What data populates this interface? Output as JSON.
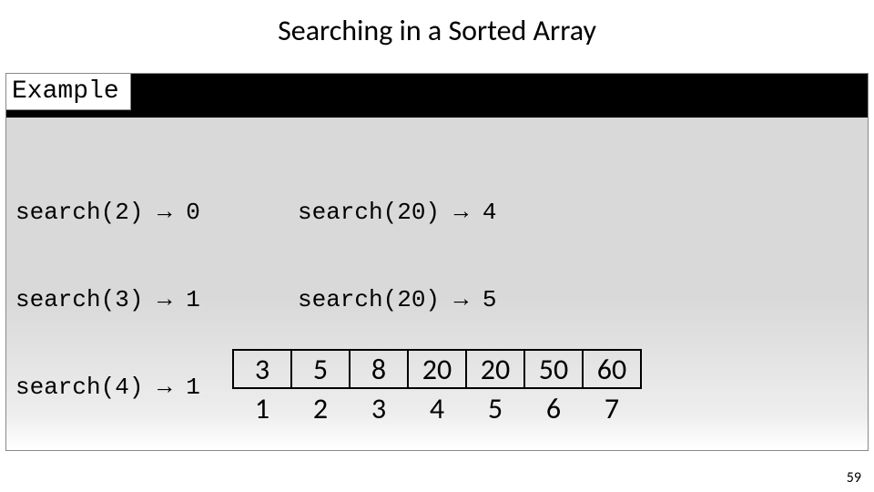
{
  "title": "Searching in a Sorted Array",
  "banner_label": "Example",
  "page_number": "59",
  "left_calls": [
    "search(2) → 0",
    "search(3) → 1",
    "search(4) → 1"
  ],
  "right_calls": [
    "search(20) → 4",
    "search(20) → 5"
  ],
  "array_values": [
    "3",
    "5",
    "8",
    "20",
    "20",
    "50",
    "60"
  ],
  "array_indices": [
    "1",
    "2",
    "3",
    "4",
    "5",
    "6",
    "7"
  ]
}
